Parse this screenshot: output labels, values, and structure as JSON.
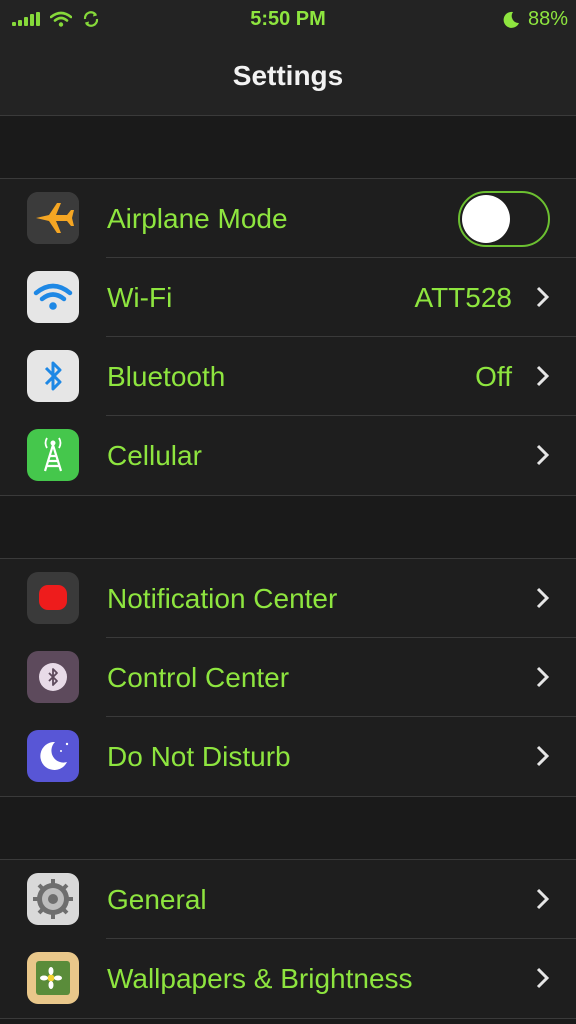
{
  "status_bar": {
    "time": "5:50 PM",
    "battery": "88%",
    "icons": [
      "signal-icon",
      "wifi-icon",
      "sync-icon",
      "moon-icon"
    ]
  },
  "nav": {
    "title": "Settings"
  },
  "groups": [
    {
      "rows": [
        {
          "label": "Airplane Mode",
          "icon": "airplane-icon",
          "toggle": true,
          "toggle_on": false
        },
        {
          "label": "Wi-Fi",
          "icon": "wifi-icon",
          "value": "ATT528"
        },
        {
          "label": "Bluetooth",
          "icon": "bluetooth-icon",
          "value": "Off"
        },
        {
          "label": "Cellular",
          "icon": "cellular-antenna-icon"
        }
      ]
    },
    {
      "rows": [
        {
          "label": "Notification Center",
          "icon": "notification-center-icon"
        },
        {
          "label": "Control Center",
          "icon": "control-center-icon"
        },
        {
          "label": "Do Not Disturb",
          "icon": "moon-icon"
        }
      ]
    },
    {
      "rows": [
        {
          "label": "General",
          "icon": "gear-icon"
        },
        {
          "label": "Wallpapers & Brightness",
          "icon": "wallpaper-flower-icon"
        }
      ]
    }
  ],
  "colors": {
    "text_accent": "#8ee53f",
    "background": "#1a1a1a",
    "cell_background": "#1e1e1e",
    "separator": "#3a3a3a"
  }
}
